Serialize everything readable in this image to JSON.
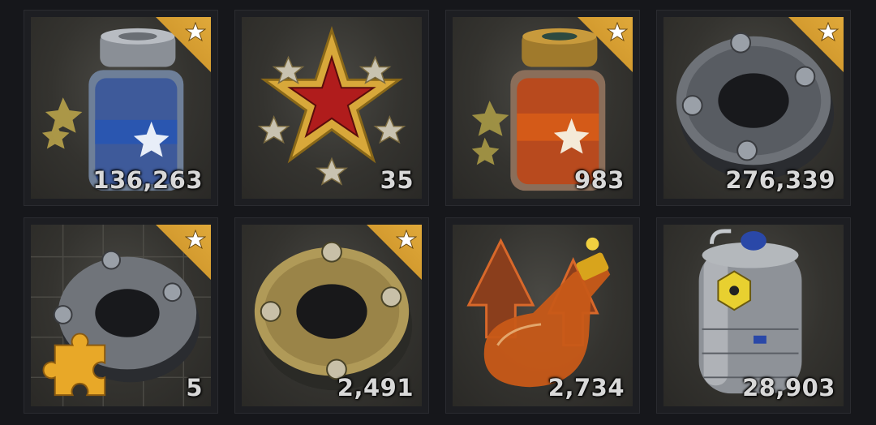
{
  "items": [
    {
      "name": "blue-star-jar",
      "count": "136,263",
      "badge": true
    },
    {
      "name": "red-star-medal",
      "count": "35",
      "badge": false
    },
    {
      "name": "orange-star-jar",
      "count": "983",
      "badge": true
    },
    {
      "name": "steel-ring-part",
      "count": "276,339",
      "badge": true
    },
    {
      "name": "ring-part-fragment",
      "count": "5",
      "badge": true
    },
    {
      "name": "gold-ring-part",
      "count": "2,491",
      "badge": true
    },
    {
      "name": "booster-flask",
      "count": "2,734",
      "badge": false
    },
    {
      "name": "coolant-canister",
      "count": "28,903",
      "badge": false
    }
  ],
  "colors": {
    "badge": "#d39a2c",
    "background": "#16171b",
    "count_text": "#d8d8d8"
  }
}
